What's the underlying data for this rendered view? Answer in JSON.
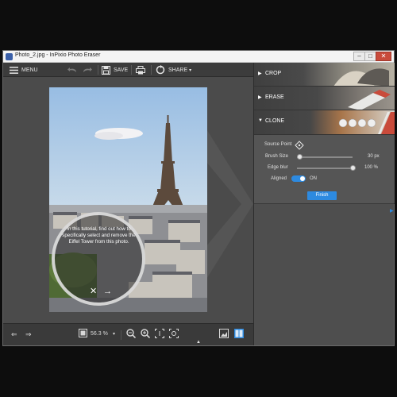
{
  "window": {
    "title": "Photo_2.jpg - InPixio Photo Eraser",
    "min_icon": "minimize-icon",
    "max_icon": "maximize-icon",
    "close_icon": "close-icon"
  },
  "toolbar": {
    "menu_label": "MENU",
    "save_label": "SAVE",
    "share_label": "SHARE"
  },
  "tutorial": {
    "text": "In this tutorial, find out how to specifically select and remove the Eiffel Tower from this photo.",
    "close_glyph": "✕",
    "next_glyph": "→"
  },
  "bottombar": {
    "zoom_value": "56.3 %"
  },
  "panel": {
    "sections": [
      {
        "label": "CROP",
        "state": "collapsed"
      },
      {
        "label": "ERASE",
        "state": "collapsed"
      },
      {
        "label": "CLONE",
        "state": "expanded"
      }
    ],
    "clone": {
      "source_point_label": "Source Point",
      "brush_size_label": "Brush Size",
      "brush_size_value": "30 px",
      "brush_size_level": 0.05,
      "edge_blur_label": "Edge blur",
      "edge_blur_value": "100 %",
      "edge_blur_level": 1.0,
      "aligned_label": "Aligned",
      "aligned_value": "ON",
      "finish_label": "Finish"
    }
  },
  "colors": {
    "accent": "#2d8ae0",
    "panel_bg": "#4e4e4e",
    "workspace_bg": "#4b4b4b",
    "close_red": "#c94b3b"
  }
}
